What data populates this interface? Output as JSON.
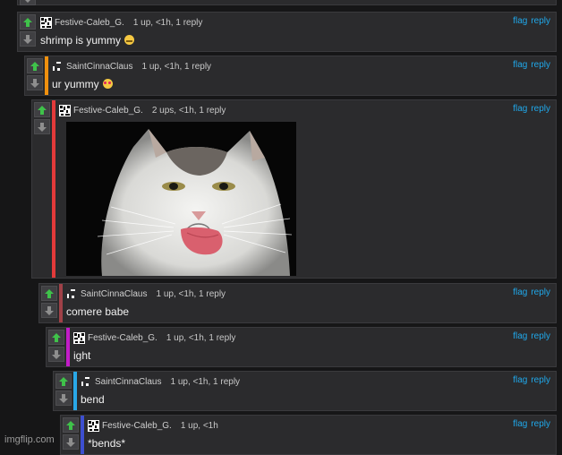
{
  "comments": [
    {
      "username": "Festive-Caleb_G.",
      "meta": "1 up, <1h, 1 reply",
      "text": "shrimp is yummy",
      "emoji": "grimacing-face-emoji",
      "stripe": "#3a3a3d"
    },
    {
      "username": "SaintCinnaClaus",
      "meta": "1 up, <1h, 1 reply",
      "text": "ur yummy",
      "emoji": "heart-eyes-face-emoji",
      "stripe": "#f0900e"
    },
    {
      "username": "Festive-Caleb_G.",
      "meta": "2 ups, <1h, 1 reply",
      "image": "cat-licking-lips-image",
      "stripe": "#e33a3a"
    },
    {
      "username": "SaintCinnaClaus",
      "meta": "1 up, <1h, 1 reply",
      "text": "comere babe",
      "stripe": "#a04148"
    },
    {
      "username": "Festive-Caleb_G.",
      "meta": "1 up, <1h, 1 reply",
      "text": "ight",
      "stripe": "#c21cc8"
    },
    {
      "username": "SaintCinnaClaus",
      "meta": "1 up, <1h, 1 reply",
      "text": "bend",
      "stripe": "#29a8e8"
    },
    {
      "username": "Festive-Caleb_G.",
      "meta": "1 up, <1h",
      "text": "*bends*",
      "stripe": "#3d4fd0"
    }
  ],
  "actions": {
    "flag": "flag",
    "reply": "reply"
  },
  "watermark": "imgflip.com",
  "colors": {
    "upvote": "#3fc24a",
    "downvote": "#8e8e8e",
    "link": "#20a8ea"
  }
}
